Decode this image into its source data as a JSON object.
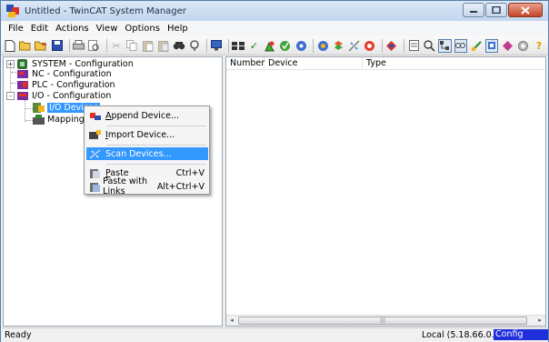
{
  "window": {
    "title": "Untitled - TwinCAT System Manager",
    "min_icon": "minimize-icon",
    "max_icon": "maximize-icon",
    "close_label": "x"
  },
  "menu": [
    "File",
    "Edit",
    "Actions",
    "View",
    "Options",
    "Help"
  ],
  "tree": {
    "items": [
      {
        "label": "SYSTEM - Configuration",
        "expander": "+"
      },
      {
        "label": "NC - Configuration",
        "expander": ""
      },
      {
        "label": "PLC - Configuration",
        "expander": ""
      },
      {
        "label": "I/O - Configuration",
        "expander": "-"
      },
      {
        "label": "I/O Devices",
        "expander": ""
      },
      {
        "label": "Mappings",
        "expander": ""
      }
    ]
  },
  "list": {
    "columns": [
      "Number",
      "Device",
      "Type"
    ],
    "scroll_left": "◂",
    "scroll_right": "▸",
    "thumb_grip": "|||"
  },
  "context_menu": {
    "append": {
      "prefix": "",
      "accel": "A",
      "rest": "ppend Device..."
    },
    "import": {
      "accel": "I",
      "rest": "mport Device..."
    },
    "scan": {
      "label": "Scan Devices..."
    },
    "paste": {
      "accel": "P",
      "rest": "aste",
      "shortcut": "Ctrl+V"
    },
    "paste_links": {
      "label": "Paste with Links",
      "shortcut": "Alt+Ctrl+V"
    }
  },
  "status": {
    "left": "Ready",
    "local": "Local (5.18.66.0.1.1)",
    "mode": "Config Mode"
  },
  "colors": {
    "selection": "#3399ff",
    "mode_badge": "#1f2fdc"
  }
}
